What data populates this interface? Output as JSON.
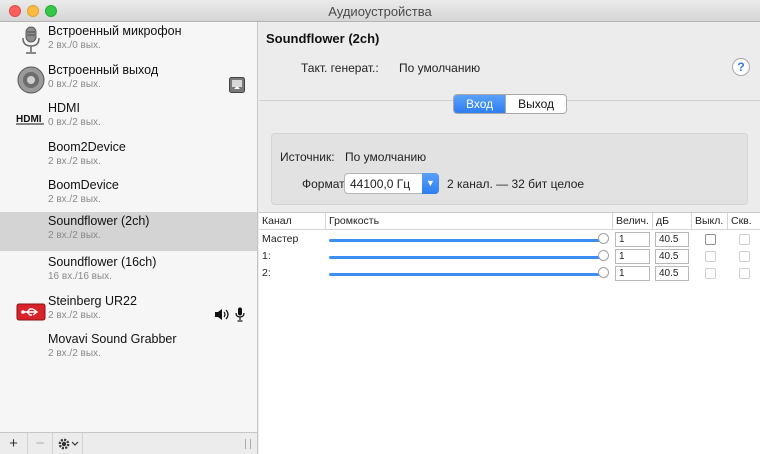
{
  "window": {
    "title": "Аудиоустройства"
  },
  "sidebar": {
    "devices": [
      {
        "name": "Встроенный микрофон",
        "io": "2 вх./0 вых.",
        "icon": "microphone-icon"
      },
      {
        "name": "Встроенный выход",
        "io": "0 вх./2 вых.",
        "icon": "speaker-icon"
      },
      {
        "name": "HDMI",
        "io": "0 вх./2 вых.",
        "icon": "hdmi-icon"
      },
      {
        "name": "Boom2Device",
        "io": "2 вх./2 вых.",
        "icon": ""
      },
      {
        "name": "BoomDevice",
        "io": "2 вх./2 вых.",
        "icon": ""
      },
      {
        "name": "Soundflower (2ch)",
        "io": "2 вх./2 вых.",
        "icon": ""
      },
      {
        "name": "Soundflower (16ch)",
        "io": "16 вх./16 вых.",
        "icon": ""
      },
      {
        "name": "Steinberg UR22",
        "io": "2 вх./2 вых.",
        "icon": "usb-interface-icon"
      },
      {
        "name": "Movavi Sound Grabber",
        "io": "2 вх./2 вых.",
        "icon": ""
      }
    ],
    "selected_index": 5,
    "bottom": {
      "add": "+",
      "remove": "−"
    }
  },
  "detail": {
    "device_title": "Soundflower (2ch)",
    "clock_label": "Такт. генерат.:",
    "clock_value": "По умолчанию",
    "help": "?",
    "tabs": [
      {
        "label": "Вход",
        "active": true
      },
      {
        "label": "Выход",
        "active": false
      }
    ],
    "source_label": "Источник:",
    "source_value": "По умолчанию",
    "format_label": "Формат:",
    "format_value": "44100,0 Гц",
    "format_desc": "2 канал. — 32 бит целое"
  },
  "table": {
    "headers": {
      "channel": "Канал",
      "volume": "Громкость",
      "value": "Велич.",
      "db": "дБ",
      "mute": "Выкл.",
      "thru": "Скв."
    },
    "rows": [
      {
        "name": "Мастер",
        "value": "1",
        "db": "40.5"
      },
      {
        "name": "1:",
        "value": "1",
        "db": "40.5"
      },
      {
        "name": "2:",
        "value": "1",
        "db": "40.5"
      }
    ]
  },
  "colors": {
    "accent": "#3d8ef3",
    "selection": "#d4d4d4"
  }
}
